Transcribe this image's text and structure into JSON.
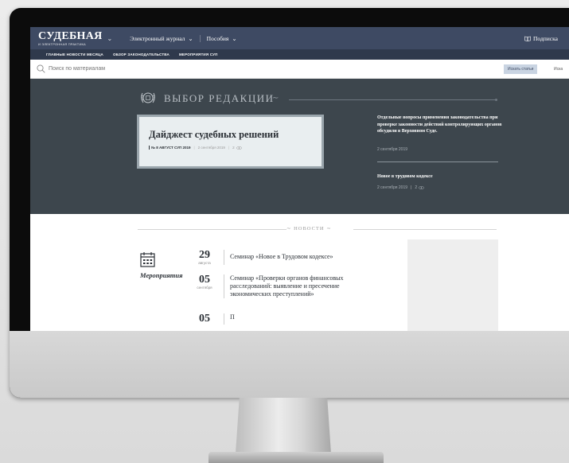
{
  "header": {
    "logo_main": "СУДЕБНАЯ",
    "logo_sub": "И ЭЛЕКТРОННАЯ ПРАКТИКА",
    "menu": [
      {
        "label": "Электронный журнал"
      },
      {
        "label": "Пособия"
      }
    ],
    "subscribe_label": "Подписка"
  },
  "nav": {
    "items": [
      {
        "label": "ГЛАВНЫЕ НОВОСТИ МЕСЯЦА"
      },
      {
        "label": "ОБЗОР ЗАКОНОДАТЕЛЬСТВА"
      },
      {
        "label": "МЕРОПРИЯТИЯ СУП"
      }
    ]
  },
  "search": {
    "placeholder": "Поиск по материалам",
    "button_label": "Искать статьи",
    "button2_label": "Иска"
  },
  "editors_choice": {
    "title": "ВЫБОР РЕДАКЦИИ",
    "card": {
      "title": "Дайджест судебных решений",
      "issue": "№ 8 АВГУСТ СУП 2019",
      "date": "2 сентября 2019",
      "views": "2"
    },
    "articles": [
      {
        "title": "Отдельные вопросы применения законодательства при проверке законности действий контролирующих органов обсудили в Верховном Суде.",
        "date": "2 сентября 2019"
      },
      {
        "title": "Новое в трудовом кодексе",
        "date": "2 сентября 2019",
        "views": "2"
      }
    ]
  },
  "news": {
    "title": "НОВОСТИ",
    "events_label": "Мероприятия",
    "events": [
      {
        "day": "29",
        "month": "августа",
        "text": "Семинар «Новое в Трудовом кодексе»"
      },
      {
        "day": "05",
        "month": "сентября",
        "text": "Семинар «Проверки органов финансовых расследований: выявление и пресечение экономических преступлений»"
      },
      {
        "day": "05",
        "month": "",
        "text": "П"
      }
    ]
  },
  "colors": {
    "header_bg": "#3e4a63",
    "nav_bg": "#2f394c",
    "editors_bg": "#3d464d",
    "card_bg": "#e9eef0"
  }
}
